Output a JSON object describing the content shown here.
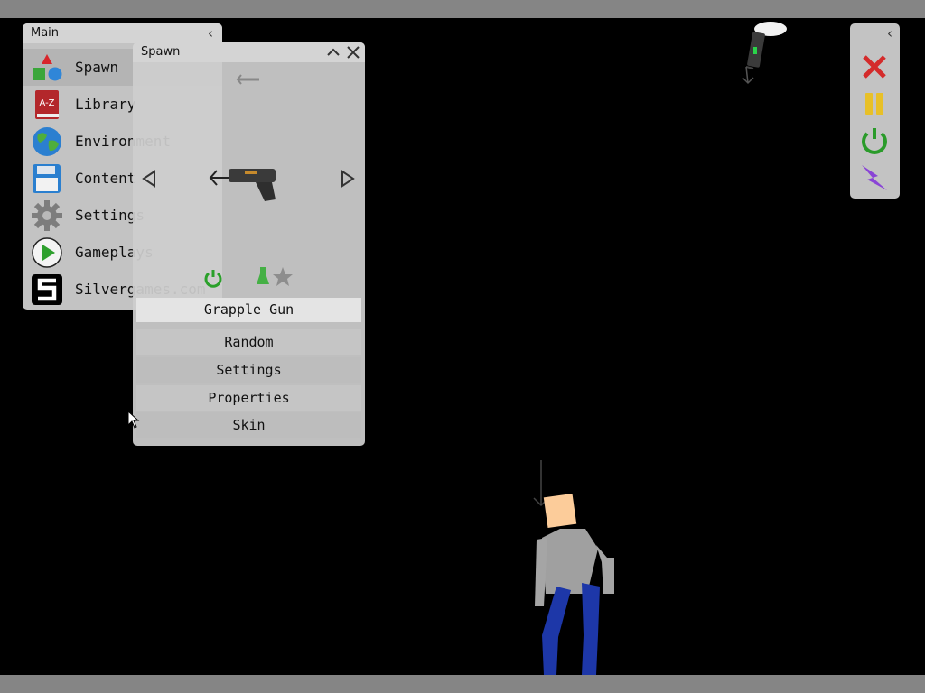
{
  "main_menu": {
    "title": "Main",
    "items": [
      {
        "label": "Spawn",
        "icon": "shapes-icon"
      },
      {
        "label": "Library",
        "icon": "a-z-book-icon"
      },
      {
        "label": "Environment",
        "icon": "globe-icon"
      },
      {
        "label": "Content",
        "icon": "floppy-disk-icon"
      },
      {
        "label": "Settings",
        "icon": "gear-icon"
      },
      {
        "label": "Gameplays",
        "icon": "play-icon"
      },
      {
        "label": "Silvergames.com",
        "icon": "silvergames-logo-icon"
      }
    ]
  },
  "spawn_panel": {
    "title": "Spawn",
    "selected_item": "Grapple Gun",
    "buttons": [
      "Random",
      "Settings",
      "Properties",
      "Skin"
    ]
  },
  "toolbar": {
    "tools": [
      {
        "name": "clear",
        "icon": "x-icon",
        "color": "#d42b2b"
      },
      {
        "name": "pause",
        "icon": "pause-icon",
        "color": "#e8c027"
      },
      {
        "name": "reset",
        "icon": "power-icon",
        "color": "#2a9b2a"
      },
      {
        "name": "slow-motion",
        "icon": "lightning-icon",
        "color": "#8a44d6"
      }
    ]
  },
  "colors": {
    "panel": "#c3c3c3",
    "background": "#000000",
    "frame": "#858585"
  }
}
